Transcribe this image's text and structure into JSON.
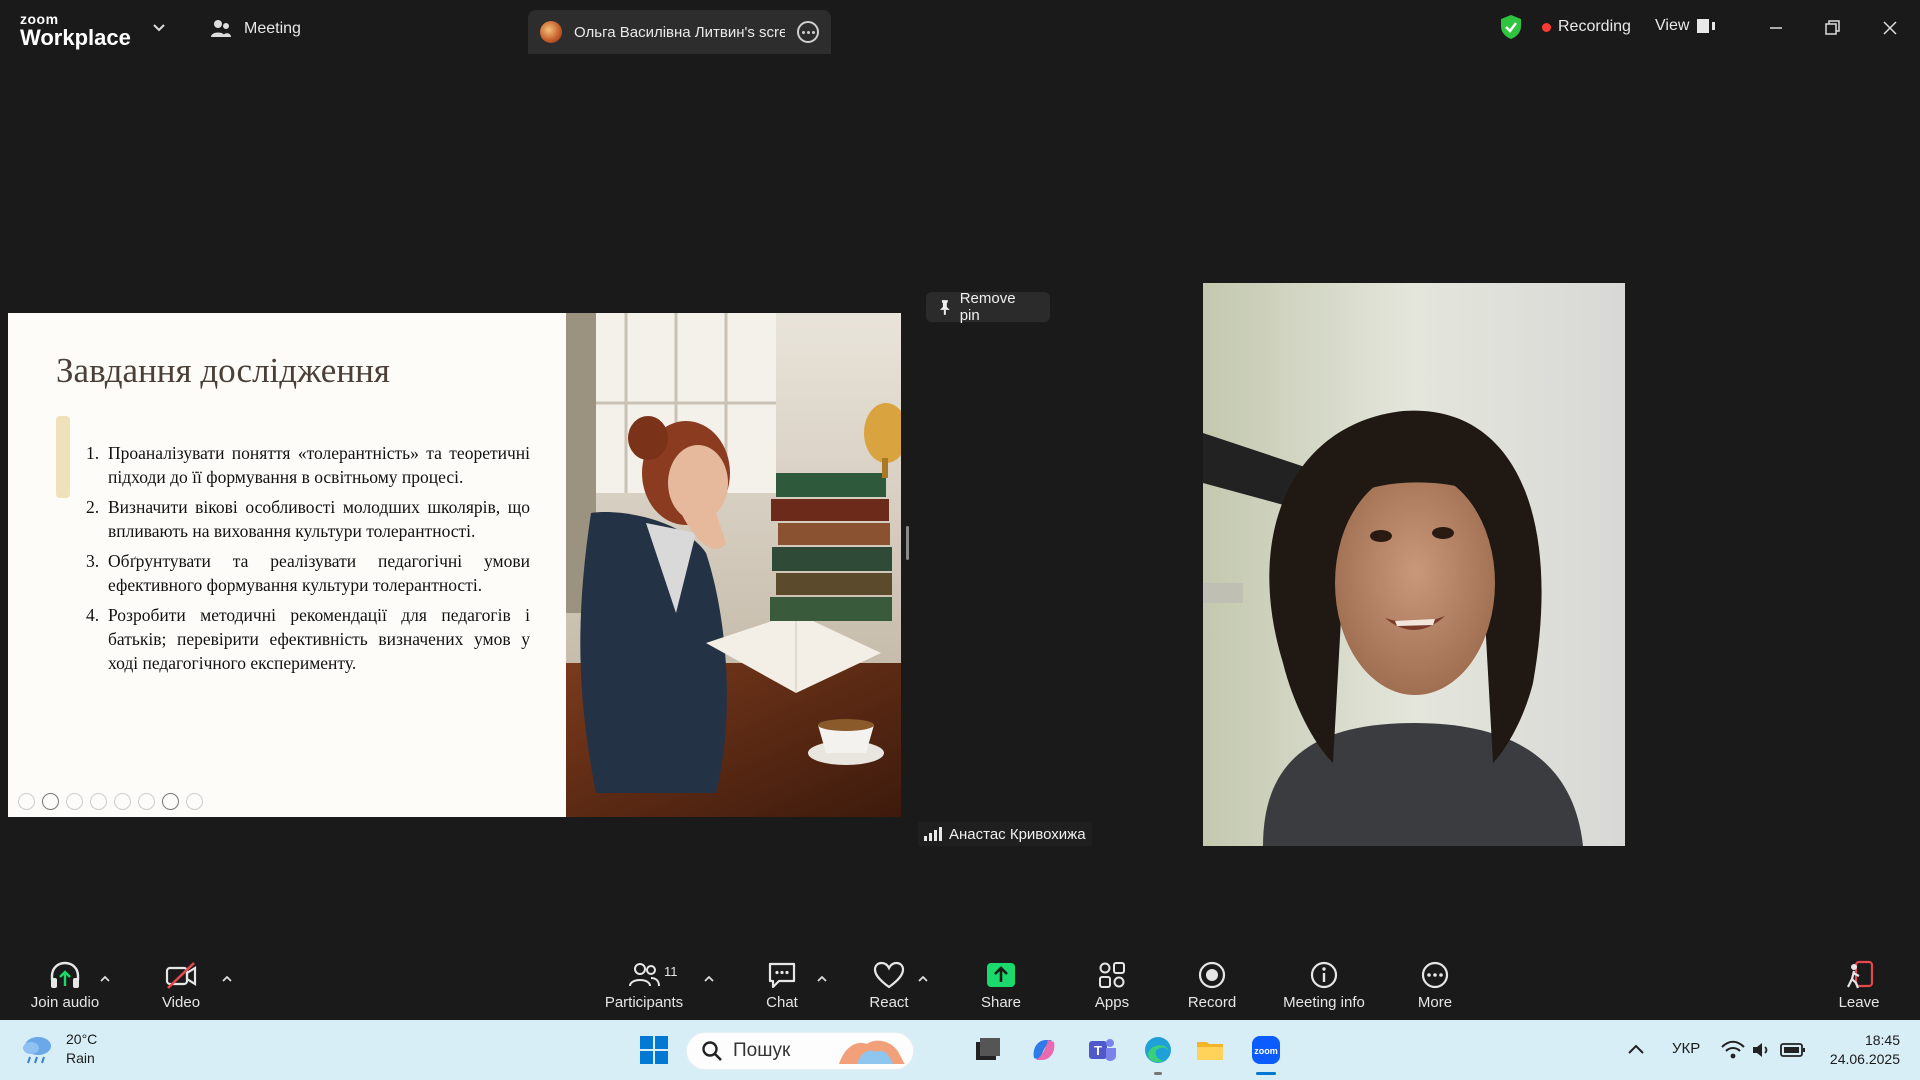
{
  "titlebar": {
    "logo_top": "zoom",
    "logo_bottom": "Workplace",
    "meeting_label": "Meeting",
    "screen_tab_label": "Ольга Василівна Литвин's screen share",
    "recording_label": "Recording",
    "view_label": "View"
  },
  "slide": {
    "title": "Завдання дослідження",
    "items": [
      {
        "num": "1.",
        "text": "Проаналізувати поняття «толерантність» та теоретичні підходи до її формування в освітньому процесі."
      },
      {
        "num": "2.",
        "text": "Визначити вікові особливості молодших школярів, що впливають на виховання культури толерантності."
      },
      {
        "num": "3.",
        "text": "Обґрунтувати та реалізувати педагогічні умови ефективного формування культури толерантності."
      },
      {
        "num": "4.",
        "text": "Розробити методичні рекомендації для педагогів і батьків; перевірити ефективність визначених умов у ході педагогічного експерименту."
      }
    ]
  },
  "pin_label": "Remove pin",
  "participant_name": "Анастас Кривохижа",
  "toolbar": {
    "join_audio": "Join audio",
    "video": "Video",
    "participants": "Participants",
    "participants_count": "11",
    "chat": "Chat",
    "react": "React",
    "share": "Share",
    "apps": "Apps",
    "record": "Record",
    "meeting_info": "Meeting info",
    "more": "More",
    "leave": "Leave"
  },
  "taskbar": {
    "temperature": "20°C",
    "weather": "Rain",
    "search_placeholder": "Пошук",
    "language": "УКР",
    "time": "18:45",
    "date": "24.06.2025"
  },
  "colors": {
    "accent_share": "#1bd96a",
    "recording_dot": "#ff3b30",
    "leave": "#e5484d",
    "shield": "#2ec440"
  }
}
